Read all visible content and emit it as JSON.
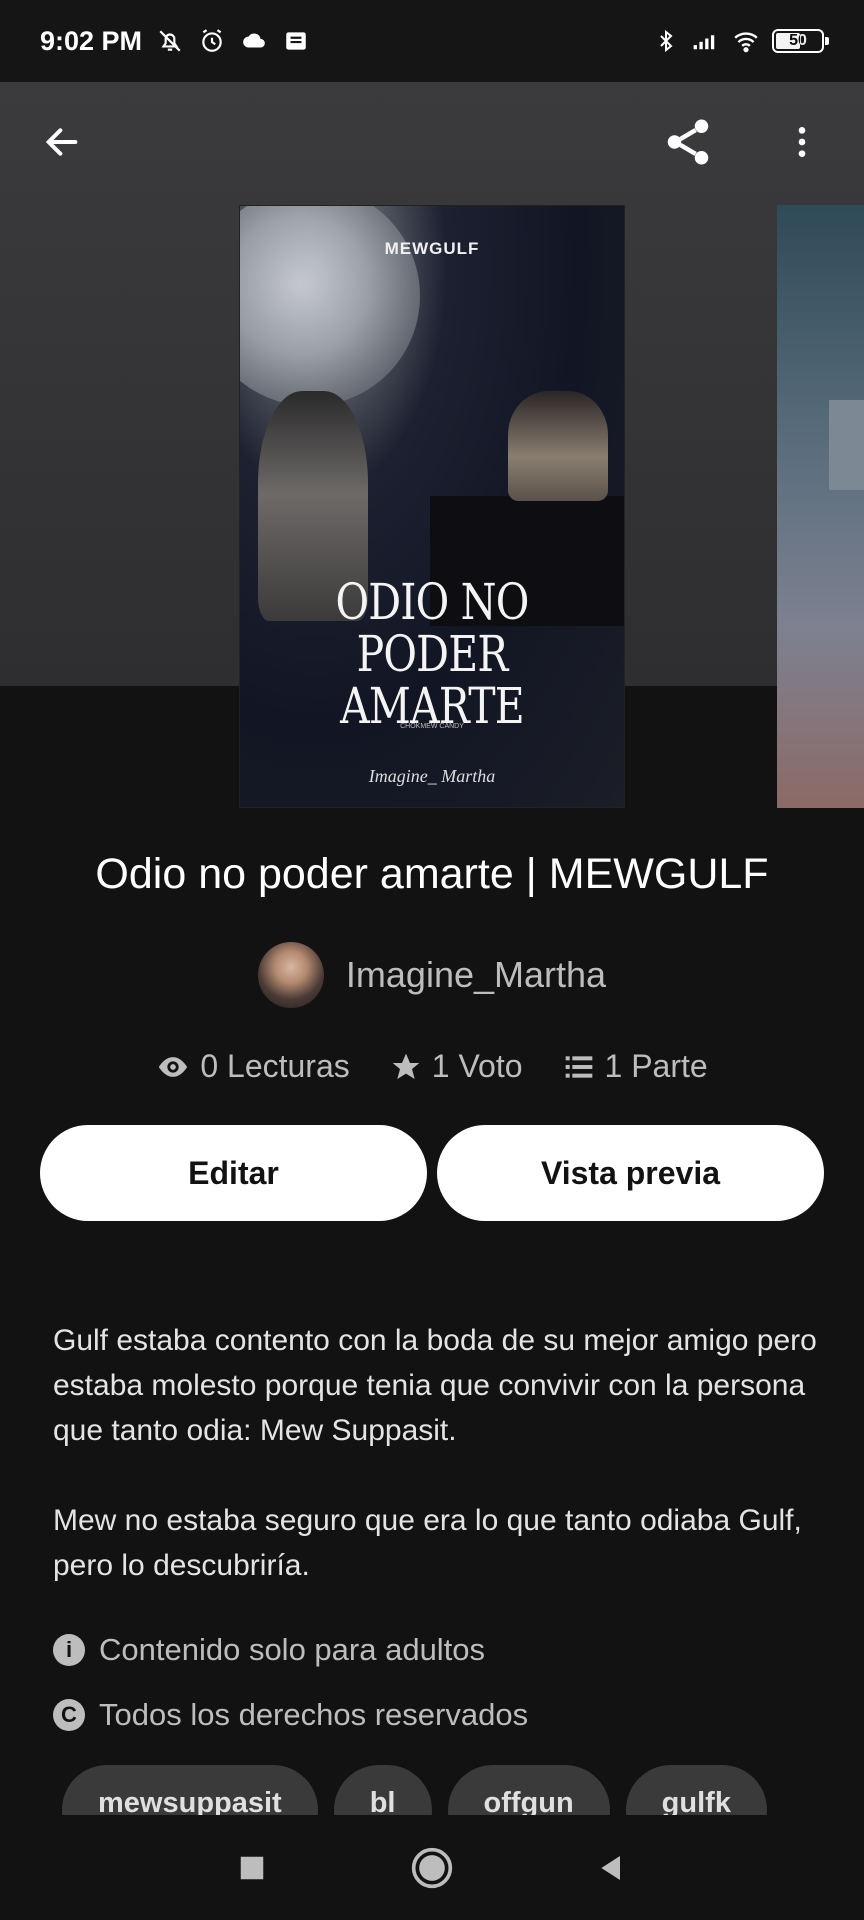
{
  "status_bar": {
    "time": "9:02 PM",
    "battery": "50",
    "icons_left": [
      "bell-off-icon",
      "alarm-icon",
      "cloud-icon",
      "message-icon"
    ],
    "icons_right": [
      "bluetooth-icon",
      "signal-icon",
      "wifi-icon",
      "battery-icon"
    ]
  },
  "top_bar": {
    "back_icon": "arrow-left-icon",
    "share_icon": "share-icon",
    "more_icon": "more-vertical-icon"
  },
  "cover": {
    "brand": "MEWGULF",
    "title_line1": "ODIO NO PODER",
    "title_line2": "AMARTE",
    "credit": "CHOKMEW CANDY",
    "signature": "Imagine_ Martha"
  },
  "book": {
    "title": "Odio no poder amarte | MEWGULF",
    "author": "Imagine_Martha"
  },
  "stats": {
    "reads": "0 Lecturas",
    "votes": "1 Voto",
    "parts": "1 Parte"
  },
  "buttons": {
    "edit": "Editar",
    "preview": "Vista previa"
  },
  "description": {
    "p1": "Gulf estaba contento con la boda de su mejor amigo pero estaba molesto porque tenia que convivir con la persona que tanto odia:  Mew Suppasit.",
    "p2": "Mew no estaba seguro que era lo que tanto odiaba Gulf, pero lo descubriría."
  },
  "meta": {
    "mature": "Contenido solo para adultos",
    "copyright": "Todos los derechos reservados"
  },
  "tags": [
    "mewsuppasit",
    "bl",
    "offgun",
    "gulfk"
  ],
  "colors": {
    "background": "#121212",
    "hero": "#333335",
    "button_bg": "#ffffff",
    "muted_text": "#bdbdbd",
    "tag_bg": "#3a3a3a"
  }
}
